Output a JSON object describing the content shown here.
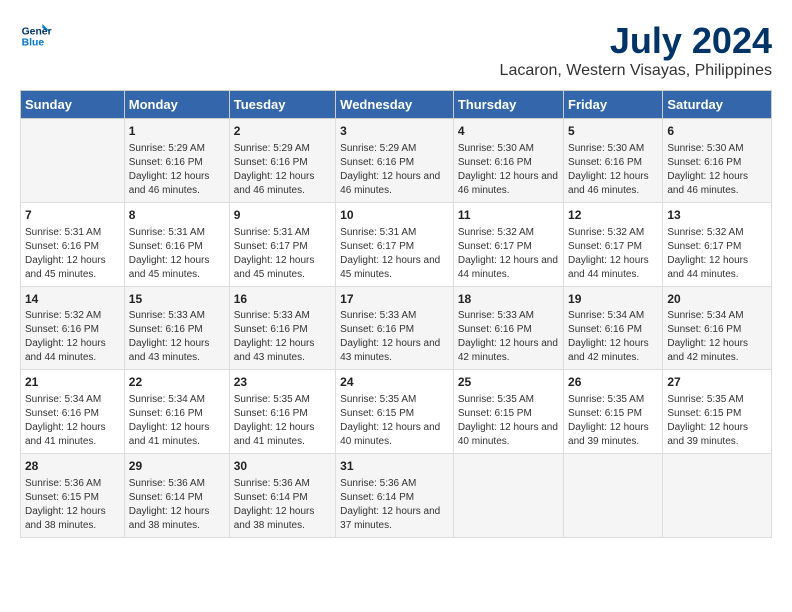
{
  "logo": {
    "line1": "General",
    "line2": "Blue"
  },
  "title": "July 2024",
  "subtitle": "Lacaron, Western Visayas, Philippines",
  "headers": [
    "Sunday",
    "Monday",
    "Tuesday",
    "Wednesday",
    "Thursday",
    "Friday",
    "Saturday"
  ],
  "weeks": [
    [
      {
        "day": "",
        "content": ""
      },
      {
        "day": "1",
        "content": "Sunrise: 5:29 AM\nSunset: 6:16 PM\nDaylight: 12 hours and 46 minutes."
      },
      {
        "day": "2",
        "content": "Sunrise: 5:29 AM\nSunset: 6:16 PM\nDaylight: 12 hours and 46 minutes."
      },
      {
        "day": "3",
        "content": "Sunrise: 5:29 AM\nSunset: 6:16 PM\nDaylight: 12 hours and 46 minutes."
      },
      {
        "day": "4",
        "content": "Sunrise: 5:30 AM\nSunset: 6:16 PM\nDaylight: 12 hours and 46 minutes."
      },
      {
        "day": "5",
        "content": "Sunrise: 5:30 AM\nSunset: 6:16 PM\nDaylight: 12 hours and 46 minutes."
      },
      {
        "day": "6",
        "content": "Sunrise: 5:30 AM\nSunset: 6:16 PM\nDaylight: 12 hours and 46 minutes."
      }
    ],
    [
      {
        "day": "7",
        "content": "Sunrise: 5:31 AM\nSunset: 6:16 PM\nDaylight: 12 hours and 45 minutes."
      },
      {
        "day": "8",
        "content": "Sunrise: 5:31 AM\nSunset: 6:16 PM\nDaylight: 12 hours and 45 minutes."
      },
      {
        "day": "9",
        "content": "Sunrise: 5:31 AM\nSunset: 6:17 PM\nDaylight: 12 hours and 45 minutes."
      },
      {
        "day": "10",
        "content": "Sunrise: 5:31 AM\nSunset: 6:17 PM\nDaylight: 12 hours and 45 minutes."
      },
      {
        "day": "11",
        "content": "Sunrise: 5:32 AM\nSunset: 6:17 PM\nDaylight: 12 hours and 44 minutes."
      },
      {
        "day": "12",
        "content": "Sunrise: 5:32 AM\nSunset: 6:17 PM\nDaylight: 12 hours and 44 minutes."
      },
      {
        "day": "13",
        "content": "Sunrise: 5:32 AM\nSunset: 6:17 PM\nDaylight: 12 hours and 44 minutes."
      }
    ],
    [
      {
        "day": "14",
        "content": "Sunrise: 5:32 AM\nSunset: 6:16 PM\nDaylight: 12 hours and 44 minutes."
      },
      {
        "day": "15",
        "content": "Sunrise: 5:33 AM\nSunset: 6:16 PM\nDaylight: 12 hours and 43 minutes."
      },
      {
        "day": "16",
        "content": "Sunrise: 5:33 AM\nSunset: 6:16 PM\nDaylight: 12 hours and 43 minutes."
      },
      {
        "day": "17",
        "content": "Sunrise: 5:33 AM\nSunset: 6:16 PM\nDaylight: 12 hours and 43 minutes."
      },
      {
        "day": "18",
        "content": "Sunrise: 5:33 AM\nSunset: 6:16 PM\nDaylight: 12 hours and 42 minutes."
      },
      {
        "day": "19",
        "content": "Sunrise: 5:34 AM\nSunset: 6:16 PM\nDaylight: 12 hours and 42 minutes."
      },
      {
        "day": "20",
        "content": "Sunrise: 5:34 AM\nSunset: 6:16 PM\nDaylight: 12 hours and 42 minutes."
      }
    ],
    [
      {
        "day": "21",
        "content": "Sunrise: 5:34 AM\nSunset: 6:16 PM\nDaylight: 12 hours and 41 minutes."
      },
      {
        "day": "22",
        "content": "Sunrise: 5:34 AM\nSunset: 6:16 PM\nDaylight: 12 hours and 41 minutes."
      },
      {
        "day": "23",
        "content": "Sunrise: 5:35 AM\nSunset: 6:16 PM\nDaylight: 12 hours and 41 minutes."
      },
      {
        "day": "24",
        "content": "Sunrise: 5:35 AM\nSunset: 6:15 PM\nDaylight: 12 hours and 40 minutes."
      },
      {
        "day": "25",
        "content": "Sunrise: 5:35 AM\nSunset: 6:15 PM\nDaylight: 12 hours and 40 minutes."
      },
      {
        "day": "26",
        "content": "Sunrise: 5:35 AM\nSunset: 6:15 PM\nDaylight: 12 hours and 39 minutes."
      },
      {
        "day": "27",
        "content": "Sunrise: 5:35 AM\nSunset: 6:15 PM\nDaylight: 12 hours and 39 minutes."
      }
    ],
    [
      {
        "day": "28",
        "content": "Sunrise: 5:36 AM\nSunset: 6:15 PM\nDaylight: 12 hours and 38 minutes."
      },
      {
        "day": "29",
        "content": "Sunrise: 5:36 AM\nSunset: 6:14 PM\nDaylight: 12 hours and 38 minutes."
      },
      {
        "day": "30",
        "content": "Sunrise: 5:36 AM\nSunset: 6:14 PM\nDaylight: 12 hours and 38 minutes."
      },
      {
        "day": "31",
        "content": "Sunrise: 5:36 AM\nSunset: 6:14 PM\nDaylight: 12 hours and 37 minutes."
      },
      {
        "day": "",
        "content": ""
      },
      {
        "day": "",
        "content": ""
      },
      {
        "day": "",
        "content": ""
      }
    ]
  ]
}
